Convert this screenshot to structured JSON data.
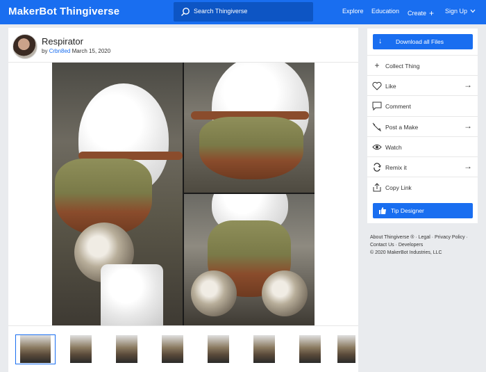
{
  "header": {
    "logo_maker": "MakerBot",
    "logo_thing": "Thingiverse",
    "search_placeholder": "Search Thingiverse",
    "nav": {
      "explore": "Explore",
      "education": "Education",
      "create": "Create",
      "signup": "Sign Up"
    },
    "brand_color": "#196ef0"
  },
  "thing": {
    "title": "Respirator",
    "by": "by",
    "author": "Crbn8ed",
    "date": "March 15, 2020"
  },
  "gallery": {
    "thumbnail_count": 8,
    "selected_index": 0
  },
  "actions": {
    "download": "Download all Files",
    "items": [
      {
        "label": "Collect Thing",
        "icon": "plus-icon",
        "arrow": false
      },
      {
        "label": "Like",
        "icon": "heart-icon",
        "arrow": true
      },
      {
        "label": "Comment",
        "icon": "comment-icon",
        "arrow": false
      },
      {
        "label": "Post a Make",
        "icon": "brush-icon",
        "arrow": true
      },
      {
        "label": "Watch",
        "icon": "eye-icon",
        "arrow": false
      },
      {
        "label": "Remix it",
        "icon": "remix-icon",
        "arrow": true
      },
      {
        "label": "Copy Link",
        "icon": "share-icon",
        "arrow": false
      }
    ],
    "tip": "Tip Designer"
  },
  "footer": {
    "about": "About Thingiverse ®",
    "legal": "Legal",
    "privacy": "Privacy Policy",
    "contact": "Contact Us",
    "developers": "Developers",
    "copyright": "© 2020 MakerBot Industries, LLC"
  }
}
